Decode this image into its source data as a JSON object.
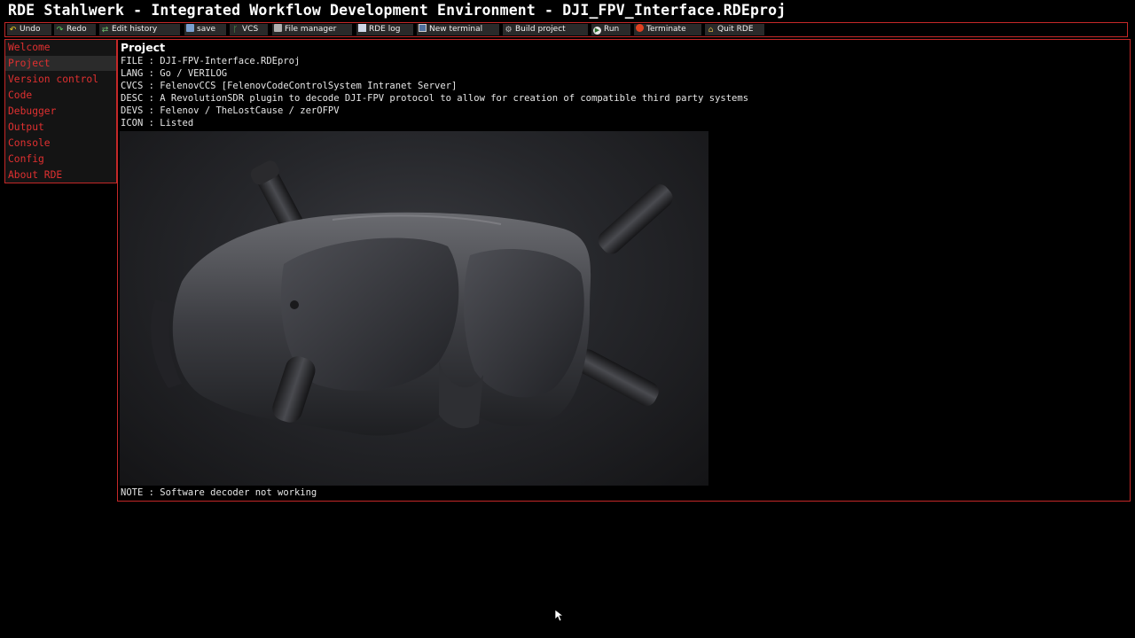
{
  "window": {
    "title": "RDE Stahlwerk - Integrated Workflow Development Environment - DJI_FPV_Interface.RDEproj"
  },
  "toolbar": {
    "undo": "Undo",
    "redo": "Redo",
    "edit_history": "Edit history",
    "save": "save",
    "vcs": "VCS",
    "file_manager": "File manager",
    "rde_log": "RDE log",
    "new_terminal": "New terminal",
    "build_project": "Build project",
    "run": "Run",
    "terminate": "Terminate",
    "quit": "Quit RDE"
  },
  "sidebar": {
    "items": [
      {
        "label": "Welcome",
        "active": false
      },
      {
        "label": "Project",
        "active": true
      },
      {
        "label": "Version control",
        "active": false
      },
      {
        "label": "Code",
        "active": false
      },
      {
        "label": "Debugger",
        "active": false
      },
      {
        "label": "Output",
        "active": false
      },
      {
        "label": "Console",
        "active": false
      },
      {
        "label": "Config",
        "active": false
      },
      {
        "label": "About RDE",
        "active": false
      }
    ]
  },
  "project": {
    "heading": "Project",
    "file": "FILE : DJI-FPV-Interface.RDEproj",
    "lang": "LANG : Go / VERILOG",
    "cvcs": "CVCS : FelenovCCS [FelenovCodeControlSystem Intranet Server]",
    "desc": "DESC : A RevolutionSDR plugin to decode DJI-FPV protocol to allow for creation of compatible third party systems",
    "devs": "DEVS : Felenov / TheLostCause / zerOFPV",
    "icon": "ICON : Listed",
    "note": "NOTE : Software decoder not working"
  },
  "colors": {
    "accent": "#c42828",
    "sidebar_text": "#e03030",
    "background": "#000000"
  }
}
